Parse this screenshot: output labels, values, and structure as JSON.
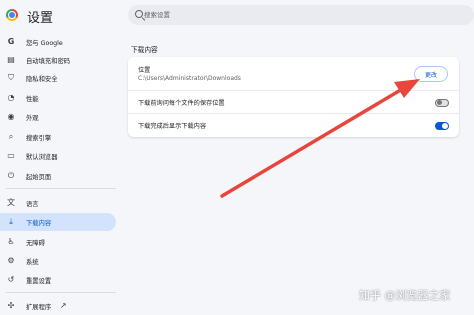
{
  "app": {
    "title": "设置"
  },
  "search": {
    "placeholder": "搜索设置"
  },
  "sidebar": {
    "items": [
      {
        "label": "您与 Google",
        "icon": "google-icon"
      },
      {
        "label": "自动填充和密码",
        "icon": "clipboard-icon"
      },
      {
        "label": "隐私和安全",
        "icon": "shield-icon"
      },
      {
        "label": "性能",
        "icon": "speedometer-icon"
      },
      {
        "label": "外观",
        "icon": "palette-icon"
      },
      {
        "label": "搜索引擎",
        "icon": "search-icon"
      },
      {
        "label": "默认浏览器",
        "icon": "browser-icon"
      },
      {
        "label": "起始页面",
        "icon": "power-icon"
      },
      {
        "label": "语言",
        "icon": "translate-icon"
      },
      {
        "label": "下载内容",
        "icon": "download-icon",
        "active": true
      },
      {
        "label": "无障碍",
        "icon": "accessibility-icon"
      },
      {
        "label": "系统",
        "icon": "wrench-icon"
      },
      {
        "label": "重置设置",
        "icon": "reset-icon"
      },
      {
        "label": "扩展程序",
        "icon": "puzzle-icon"
      }
    ]
  },
  "downloads": {
    "section_title": "下载内容",
    "location_label": "位置",
    "location_path": "C:\\Users\\Administrator\\Downloads",
    "change_button": "更改",
    "ask_where_label": "下载前询问每个文件的保存位置",
    "ask_where_enabled": false,
    "show_when_done_label": "下载完成后显示下载内容",
    "show_when_done_enabled": true
  },
  "annotation": {
    "arrow_color": "#e8453c"
  },
  "watermark": {
    "text": "知乎 @浏览器之家"
  },
  "colors": {
    "accent": "#0b57d0",
    "active_nav_bg": "#d3e3fd",
    "page_bg": "#f5f6f9"
  }
}
